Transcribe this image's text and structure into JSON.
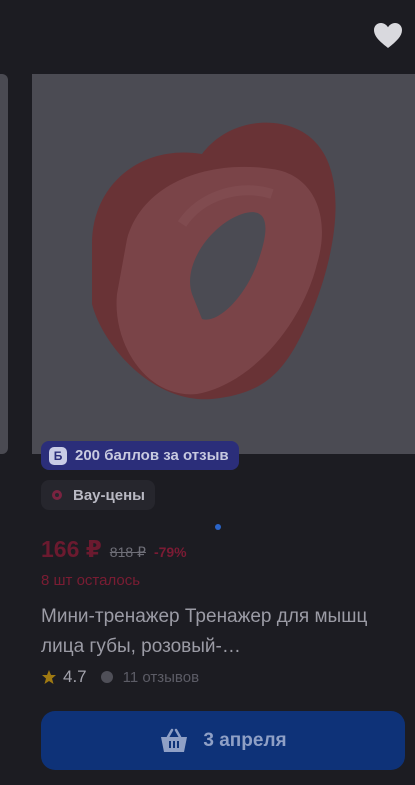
{
  "header": {
    "favorite_icon": "heart-icon"
  },
  "product": {
    "bonus_label": "200 баллов за отзыв",
    "bonus_icon_letter": "Б",
    "promo_label": "Вау-цены",
    "price_current": "166 ₽",
    "price_old": "818 ₽",
    "discount": "-79%",
    "stock_note": "8 шт осталось",
    "title": "Мини-тренажер Тренажер для мышц лица губы, розовый-…",
    "rating": "4.7",
    "reviews": "11 отзывов"
  },
  "cart_button": {
    "label": "3 апреля",
    "icon": "basket-icon"
  },
  "colors": {
    "background": "#1c1c22",
    "badge": "#2b2e7a",
    "price": "#6b1a2f",
    "button": "#0e3278"
  }
}
